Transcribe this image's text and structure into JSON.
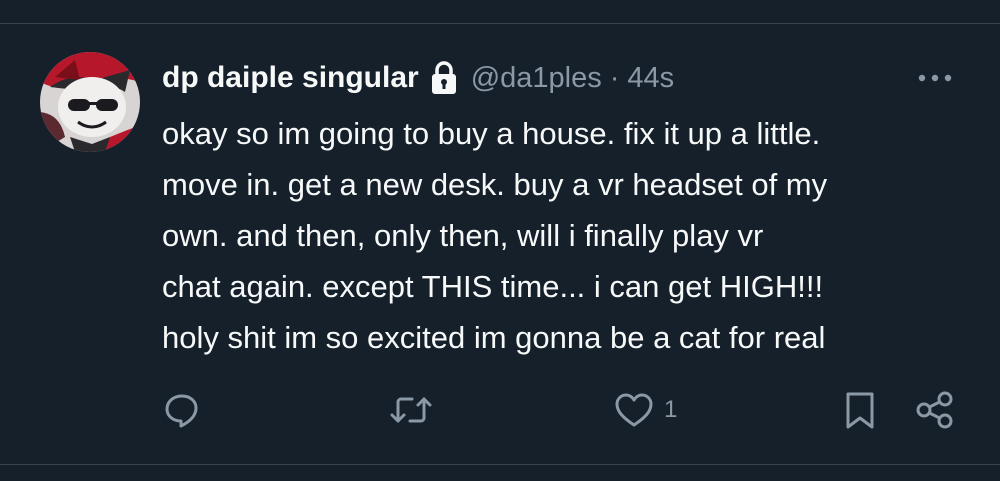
{
  "tweet": {
    "author": {
      "display_name": "dp daiple singular",
      "handle": "@da1ples",
      "protected": true,
      "avatar": "cartoon-cat-avatar"
    },
    "separator": "·",
    "time": "44s",
    "text_lines": [
      "okay so im going to buy a house. fix it up a little.",
      "move in. get a new desk. buy a vr headset of my",
      "own. and then, only then, will i finally play vr",
      "chat again. except THIS time... i can get HIGH!!!",
      "holy shit im so excited im gonna be a cat for real"
    ],
    "actions": {
      "reply_icon": "reply-icon",
      "retweet_icon": "retweet-icon",
      "like_icon": "heart-icon",
      "like_count": "1",
      "bookmark_icon": "bookmark-icon",
      "share_icon": "share-icon"
    }
  },
  "colors": {
    "background": "#15202b",
    "primary_text": "#f7f9f9",
    "secondary_text": "#8b98a5",
    "divider": "#38444d"
  }
}
